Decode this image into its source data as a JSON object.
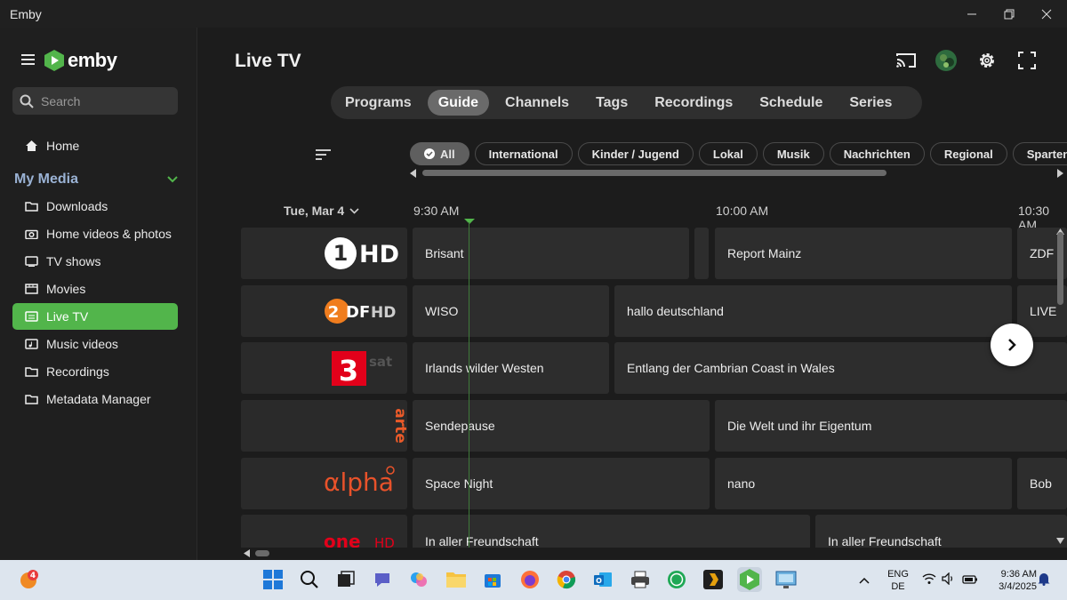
{
  "window": {
    "title": "Emby"
  },
  "sidebar": {
    "brand": "emby",
    "search_placeholder": "Search",
    "home": "Home",
    "section": "My Media",
    "items": [
      {
        "label": "Downloads",
        "icon": "folder-icon"
      },
      {
        "label": "Home videos & photos",
        "icon": "camera-icon"
      },
      {
        "label": "TV shows",
        "icon": "tv-icon"
      },
      {
        "label": "Movies",
        "icon": "film-icon"
      },
      {
        "label": "Live TV",
        "icon": "live-tv-icon",
        "active": true
      },
      {
        "label": "Music videos",
        "icon": "music-video-icon"
      },
      {
        "label": "Recordings",
        "icon": "folder-icon"
      },
      {
        "label": "Metadata Manager",
        "icon": "folder-icon"
      }
    ]
  },
  "header": {
    "title": "Live TV"
  },
  "tabs": [
    "Programs",
    "Guide",
    "Channels",
    "Tags",
    "Recordings",
    "Schedule",
    "Series"
  ],
  "active_tab": "Guide",
  "chips": [
    "All",
    "International",
    "Kinder / Jugend",
    "Lokal",
    "Musik",
    "Nachrichten",
    "Regional",
    "Spartenpr"
  ],
  "guide": {
    "date": "Tue, Mar 4",
    "times": [
      "9:30 AM",
      "10:00 AM",
      "10:30 AM"
    ],
    "channels": [
      {
        "logo": "1HD",
        "programs": [
          "Brisant",
          "",
          "Report Mainz",
          "ZDF"
        ]
      },
      {
        "logo": "ZDF HD",
        "programs": [
          "WISO",
          "hallo deutschland",
          "LIVE"
        ]
      },
      {
        "logo": "3sat",
        "programs": [
          "Irlands wilder Westen",
          "Entlang der Cambrian Coast in Wales"
        ]
      },
      {
        "logo": "arte",
        "programs": [
          "Sendepause",
          "Die Welt und ihr Eigentum"
        ]
      },
      {
        "logo": "alpha",
        "programs": [
          "Space Night",
          "nano",
          "Bob"
        ]
      },
      {
        "logo": "one HD",
        "programs": [
          "In aller Freundschaft",
          "In aller Freundschaft"
        ]
      }
    ]
  },
  "taskbar": {
    "badge": "4",
    "lang_top": "ENG",
    "lang_bottom": "DE",
    "time": "9:36 AM",
    "date": "3/4/2025"
  },
  "colors": {
    "accent": "#52b54b",
    "background": "#1c1c1c",
    "sidebar": "#1f1f1f",
    "taskbar": "#dde5ee"
  }
}
